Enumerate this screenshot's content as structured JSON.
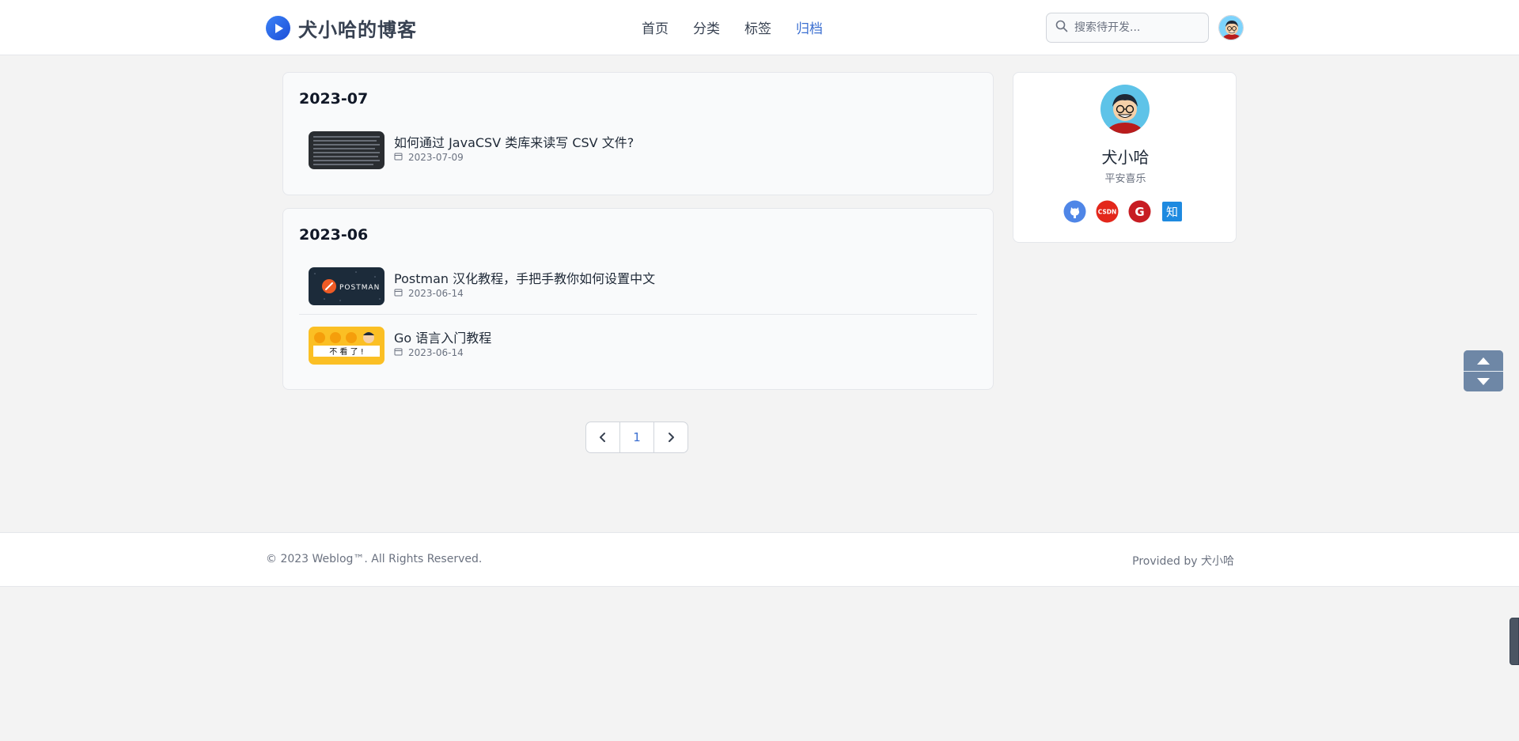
{
  "header": {
    "brand_title": "犬小哈的博客",
    "nav": [
      {
        "label": "首页",
        "active": false
      },
      {
        "label": "分类",
        "active": false
      },
      {
        "label": "标签",
        "active": false
      },
      {
        "label": "归档",
        "active": true
      }
    ],
    "search_placeholder": "搜索待开发..."
  },
  "archives": [
    {
      "month": "2023-07",
      "entries": [
        {
          "title": "如何通过 JavaCSV 类库来读写 CSV 文件?",
          "date": "2023-07-09",
          "thumb": "code-screenshot"
        }
      ]
    },
    {
      "month": "2023-06",
      "entries": [
        {
          "title": "Postman 汉化教程，手把手教你如何设置中文",
          "date": "2023-06-14",
          "thumb": "postman-banner",
          "thumb_text": "POSTMAN"
        },
        {
          "title": "Go 语言入门教程",
          "date": "2023-06-14",
          "thumb": "cartoon-dogs",
          "thumb_text": "不 看 了 !"
        }
      ]
    }
  ],
  "profile": {
    "name": "犬小哈",
    "motto": "平安喜乐",
    "socials": [
      {
        "icon": "github-icon",
        "color": "#4f86e7"
      },
      {
        "icon": "csdn-icon",
        "color": "#e3271b",
        "text": "CSDN"
      },
      {
        "icon": "gitee-icon",
        "color": "#c71d23",
        "text": "G"
      },
      {
        "icon": "zhihu-icon",
        "color": "#1e8ae0",
        "text": "知"
      }
    ]
  },
  "pagination": {
    "prev": "‹",
    "current": "1",
    "next": "›"
  },
  "footer": {
    "copyright": "© 2023 Weblog™. All Rights Reserved.",
    "provided": "Provided by 犬小哈"
  },
  "colors": {
    "accent": "#3b6fd1",
    "scroll_widget": "#6e87a6"
  }
}
